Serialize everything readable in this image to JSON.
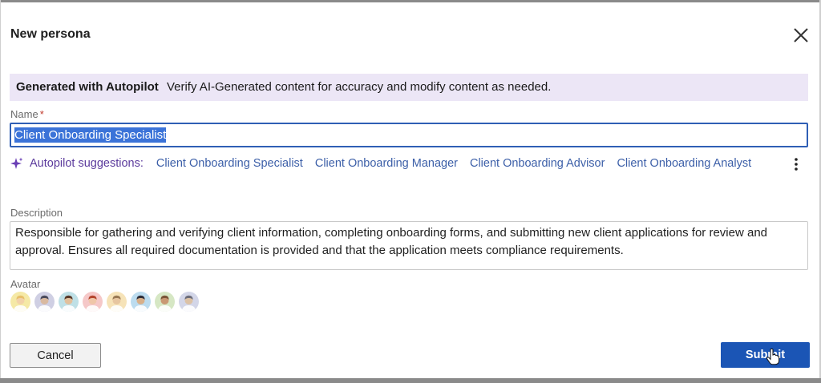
{
  "dialog": {
    "title": "New persona"
  },
  "banner": {
    "bold": "Generated with Autopilot",
    "text": "Verify AI-Generated content for accuracy and modify content as needed."
  },
  "name_field": {
    "label": "Name",
    "required_mark": "*",
    "value": "Client Onboarding Specialist"
  },
  "suggestions": {
    "lead": "Autopilot suggestions:",
    "items": [
      "Client Onboarding Specialist",
      "Client Onboarding Manager",
      "Client Onboarding Advisor",
      "Client Onboarding Analyst"
    ]
  },
  "description_field": {
    "label": "Description",
    "value": "Responsible for gathering and verifying client information, completing onboarding forms, and submitting new client applications for review and approval. Ensures all required documentation is provided and that the application meets compliance requirements."
  },
  "avatar_field": {
    "label": "Avatar",
    "avatars": [
      {
        "bg": "#f5e9a6",
        "skin": "#f2d2a9",
        "hair": "#e8c06a"
      },
      {
        "bg": "#cfcfe3",
        "skin": "#d9b9a0",
        "hair": "#4b4b5c"
      },
      {
        "bg": "#bfe0e6",
        "skin": "#e2c09c",
        "hair": "#5a3b2b"
      },
      {
        "bg": "#f5c8c8",
        "skin": "#efc6a8",
        "hair": "#b5462f"
      },
      {
        "bg": "#f6e3b8",
        "skin": "#e7c6a0",
        "hair": "#9a7a55"
      },
      {
        "bg": "#bcdcef",
        "skin": "#d8b08a",
        "hair": "#2f2f3a"
      },
      {
        "bg": "#d6e7c4",
        "skin": "#c99873",
        "hair": "#7b5638"
      },
      {
        "bg": "#d3d6e8",
        "skin": "#dcc2a6",
        "hair": "#6d6d7a"
      }
    ]
  },
  "buttons": {
    "cancel": "Cancel",
    "submit": "Submit"
  },
  "colors": {
    "primary": "#1b55b5",
    "banner_bg": "#ece6f6",
    "suggestion_link": "#3c5fa8",
    "autopilot_purple": "#5b3a9c"
  }
}
